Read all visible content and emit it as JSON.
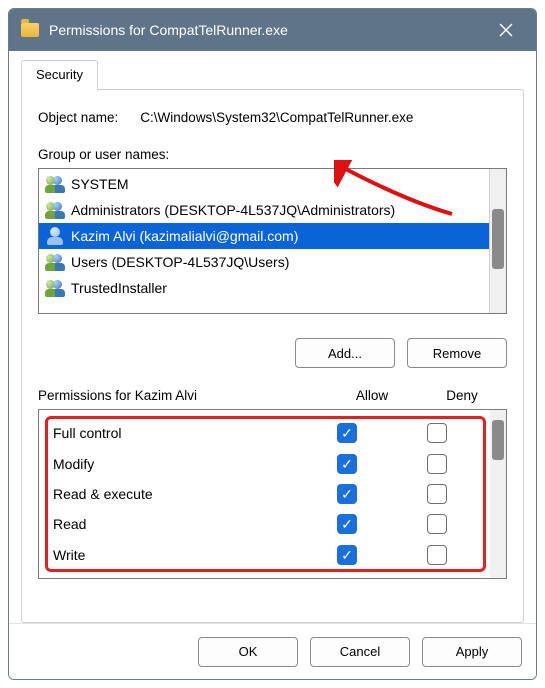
{
  "window": {
    "title": "Permissions for CompatTelRunner.exe"
  },
  "tabs": [
    {
      "label": "Security",
      "active": true
    }
  ],
  "object": {
    "label": "Object name:",
    "value": "C:\\Windows\\System32\\CompatTelRunner.exe"
  },
  "group_label": "Group or user names:",
  "principals": [
    {
      "icon": "group",
      "label": "SYSTEM",
      "selected": false
    },
    {
      "icon": "group",
      "label": "Administrators (DESKTOP-4L537JQ\\Administrators)",
      "selected": false
    },
    {
      "icon": "user",
      "label": "Kazim Alvi (kazimalialvi@gmail.com)",
      "selected": true
    },
    {
      "icon": "group",
      "label": "Users (DESKTOP-4L537JQ\\Users)",
      "selected": false
    },
    {
      "icon": "group",
      "label": "TrustedInstaller",
      "selected": false
    }
  ],
  "buttons": {
    "add": "Add...",
    "remove": "Remove"
  },
  "perm_header": {
    "title": "Permissions for Kazim Alvi",
    "allow": "Allow",
    "deny": "Deny"
  },
  "permissions": [
    {
      "name": "Full control",
      "allow": true,
      "deny": false
    },
    {
      "name": "Modify",
      "allow": true,
      "deny": false
    },
    {
      "name": "Read & execute",
      "allow": true,
      "deny": false
    },
    {
      "name": "Read",
      "allow": true,
      "deny": false
    },
    {
      "name": "Write",
      "allow": true,
      "deny": false
    }
  ],
  "footer": {
    "ok": "OK",
    "cancel": "Cancel",
    "apply": "Apply"
  }
}
